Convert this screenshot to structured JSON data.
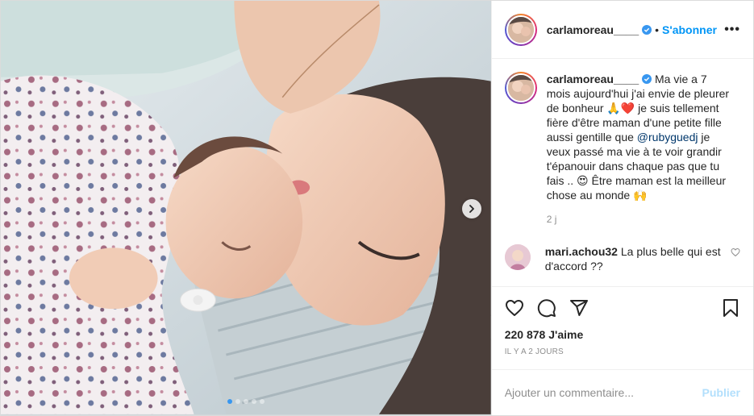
{
  "header": {
    "username": "carlamoreau____",
    "separator": "•",
    "follow_label": "S'abonner",
    "more_label": "•••"
  },
  "caption": {
    "username": "carlamoreau____",
    "text_part1": " Ma vie a 7 mois aujourd'hui j'ai envie de pleurer de bonheur 🙏❤️ je suis tellement fière d'être maman d'une petite fille aussi gentille que ",
    "mention": "@rubyguedj",
    "text_part2": " je veux passé ma vie à te voir grandir t'épanouir dans chaque pas que tu fais .. 😍 Être maman est la meilleur chose au monde 🙌",
    "time": "2 j"
  },
  "comments": [
    {
      "username": "mari.achou32",
      "text": " La plus belle qui est d'accord ??"
    }
  ],
  "stats": {
    "likes": "220 878 J'aime",
    "date": "IL Y A 2 JOURS"
  },
  "add_comment": {
    "placeholder": "Ajouter un commentaire...",
    "publish_label": "Publier"
  },
  "carousel": {
    "slide_count": 5,
    "active_index": 0
  },
  "colors": {
    "accent": "#0095f6",
    "verified": "#3897f0",
    "publish_disabled": "#b2dffc"
  },
  "icons": [
    "verified-badge-icon",
    "chevron-right-icon",
    "heart-icon",
    "comment-icon",
    "share-icon",
    "bookmark-icon",
    "more-icon"
  ]
}
